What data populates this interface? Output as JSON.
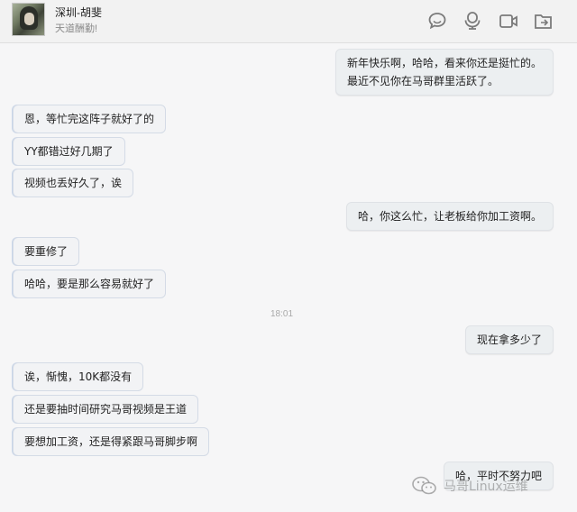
{
  "header": {
    "contact_name": "深圳-胡斐",
    "contact_status": "天道酬勤!",
    "icons": [
      "chat-bubble-icon",
      "headset-icon",
      "video-camera-icon",
      "share-icon"
    ]
  },
  "messages": [
    {
      "direction": "out",
      "lines": [
        "新年快乐啊，哈哈，看来你还是挺忙的。",
        "最近不见你在马哥群里活跃了。"
      ]
    },
    {
      "direction": "in",
      "lines": [
        "恩，等忙完这阵子就好了的"
      ]
    },
    {
      "direction": "in",
      "lines": [
        "YY都错过好几期了"
      ]
    },
    {
      "direction": "in",
      "lines": [
        "视频也丢好久了，诶"
      ]
    },
    {
      "direction": "out",
      "lines": [
        "哈，你这么忙，让老板给你加工资啊。"
      ]
    },
    {
      "direction": "in",
      "lines": [
        "要重修了"
      ]
    },
    {
      "direction": "in",
      "lines": [
        "哈哈，要是那么容易就好了"
      ]
    },
    {
      "direction": "system",
      "lines": [
        "18:01"
      ]
    },
    {
      "direction": "out",
      "lines": [
        "现在拿多少了"
      ]
    },
    {
      "direction": "in",
      "lines": [
        "诶，惭愧，10K都没有"
      ]
    },
    {
      "direction": "in",
      "lines": [
        "还是要抽时间研究马哥视频是王道"
      ]
    },
    {
      "direction": "in",
      "lines": [
        "要想加工资，还是得紧跟马哥脚步啊"
      ]
    },
    {
      "direction": "out",
      "lines": [
        "哈，平时不努力吧"
      ]
    }
  ],
  "watermark": {
    "text": "马哥Linux运维"
  },
  "colors": {
    "incoming_border": "#d4dbe6",
    "outgoing_bg": "#eceff1",
    "icon": "#7a7a7a"
  }
}
